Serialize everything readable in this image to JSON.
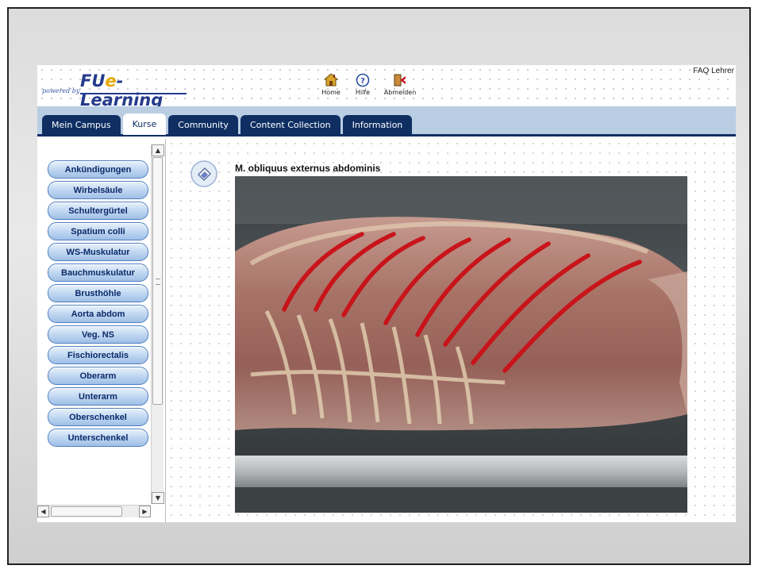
{
  "header": {
    "logo": {
      "powered": "powered by",
      "brand_prefix": "FU",
      "brand_e": "e",
      "brand_suffix": "-Learning"
    },
    "nav": [
      {
        "label": "Home",
        "icon": "home-icon"
      },
      {
        "label": "Hilfe",
        "icon": "help-icon"
      },
      {
        "label": "Abmelden",
        "icon": "logout-icon"
      }
    ],
    "faq": "FAQ Lehrer"
  },
  "tabs": [
    {
      "label": "Mein Campus",
      "active": false
    },
    {
      "label": "Kurse",
      "active": true
    },
    {
      "label": "Community",
      "active": false
    },
    {
      "label": "Content Collection",
      "active": false
    },
    {
      "label": "Information",
      "active": false
    }
  ],
  "menu": [
    "Ankündigungen",
    "Wirbelsäule",
    "Schultergürtel",
    "Spatium colli",
    "WS-Muskulatur",
    "Bauchmuskulatur",
    "Brusthöhle",
    "Aorta abdom",
    "Veg. NS",
    "Fischiorectalis",
    "Oberarm",
    "Unterarm",
    "Oberschenkel",
    "Unterschenkel"
  ],
  "content": {
    "title": "M. obliquus externus abdominis",
    "item_icon": "document-icon",
    "image": "anatomy-photo"
  },
  "colors": {
    "tab_dark": "#0f2f63",
    "tabbar_bg": "#b9cde3",
    "menu_btn": "#bdd5f0",
    "annotation_red": "#c8141a"
  }
}
